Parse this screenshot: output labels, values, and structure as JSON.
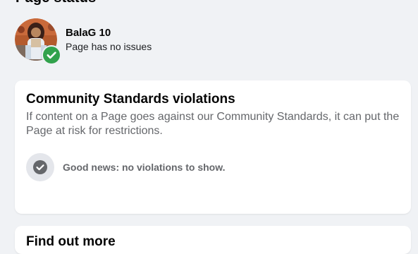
{
  "header": {
    "cut_off_heading": "Page status"
  },
  "page": {
    "name": "BalaG 10",
    "status": "Page has no issues",
    "avatar_icon": "profile-photo",
    "status_icon": "green-checkmark-icon"
  },
  "community_standards": {
    "title": "Community Standards violations",
    "description": "If content on a Page goes against our Community Standards, it can put the Page at risk for restrictions.",
    "empty_icon": "gray-checkmark-icon",
    "empty_message": "Good news: no violations to show."
  },
  "find_out_more": {
    "title": "Find out more"
  },
  "colors": {
    "background": "#f0f2f5",
    "card": "#ffffff",
    "success_green": "#31a24c",
    "muted_text": "#65676b"
  }
}
